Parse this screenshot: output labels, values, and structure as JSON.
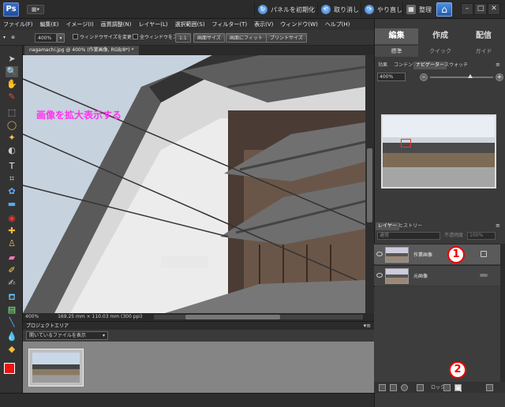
{
  "app": {
    "logo": "Ps"
  },
  "topbar": {
    "reset_panels": "パネルを初期化",
    "undo": "取り消し",
    "redo": "やり直し",
    "organize": "整理"
  },
  "menu": [
    "ファイル(F)",
    "編集(E)",
    "イメージ(I)",
    "画質調整(N)",
    "レイヤー(L)",
    "選択範囲(S)",
    "フィルター(T)",
    "表示(V)",
    "ウィンドウ(W)",
    "ヘルプ(H)"
  ],
  "options": {
    "zoom_value": "400%",
    "resize_windows": "ウィンドウサイズを変更",
    "zoom_all_windows": "全ウィンドウをズーム",
    "ratio_1_1": "1:1",
    "screen_size": "画面サイズ",
    "fit_screen": "画面にフィット",
    "print_size": "プリントサイズ"
  },
  "document": {
    "tab_title": "nagamachi.jpg @ 400% (作業画像, RGB/8*) *",
    "annotation": "画像を拡大表示する",
    "status_zoom": "400%",
    "status_info": "169.25 mm × 110.03 mm (300 ppi)"
  },
  "project_bin": {
    "title": "プロジェクトエリア",
    "filter": "開いているファイルを表示"
  },
  "right_panel": {
    "modes": [
      "編集",
      "作成",
      "配信"
    ],
    "submodes": [
      "標準",
      "クイック",
      "ガイド"
    ],
    "palette_tabs": [
      "効果",
      "コンテンツ",
      "ナビゲーター",
      "スウォッチ"
    ],
    "nav_zoom": "400%",
    "layer_tabs": [
      "レイヤー",
      "ヒストリー"
    ],
    "blend_mode": "通常",
    "opacity_label": "不透明度",
    "opacity_value": "100%",
    "layers": [
      {
        "name": "作業画像",
        "active": true
      },
      {
        "name": "元画像",
        "active": false
      }
    ],
    "lock_label": "ロック"
  },
  "callouts": {
    "one": "1",
    "two": "2"
  }
}
